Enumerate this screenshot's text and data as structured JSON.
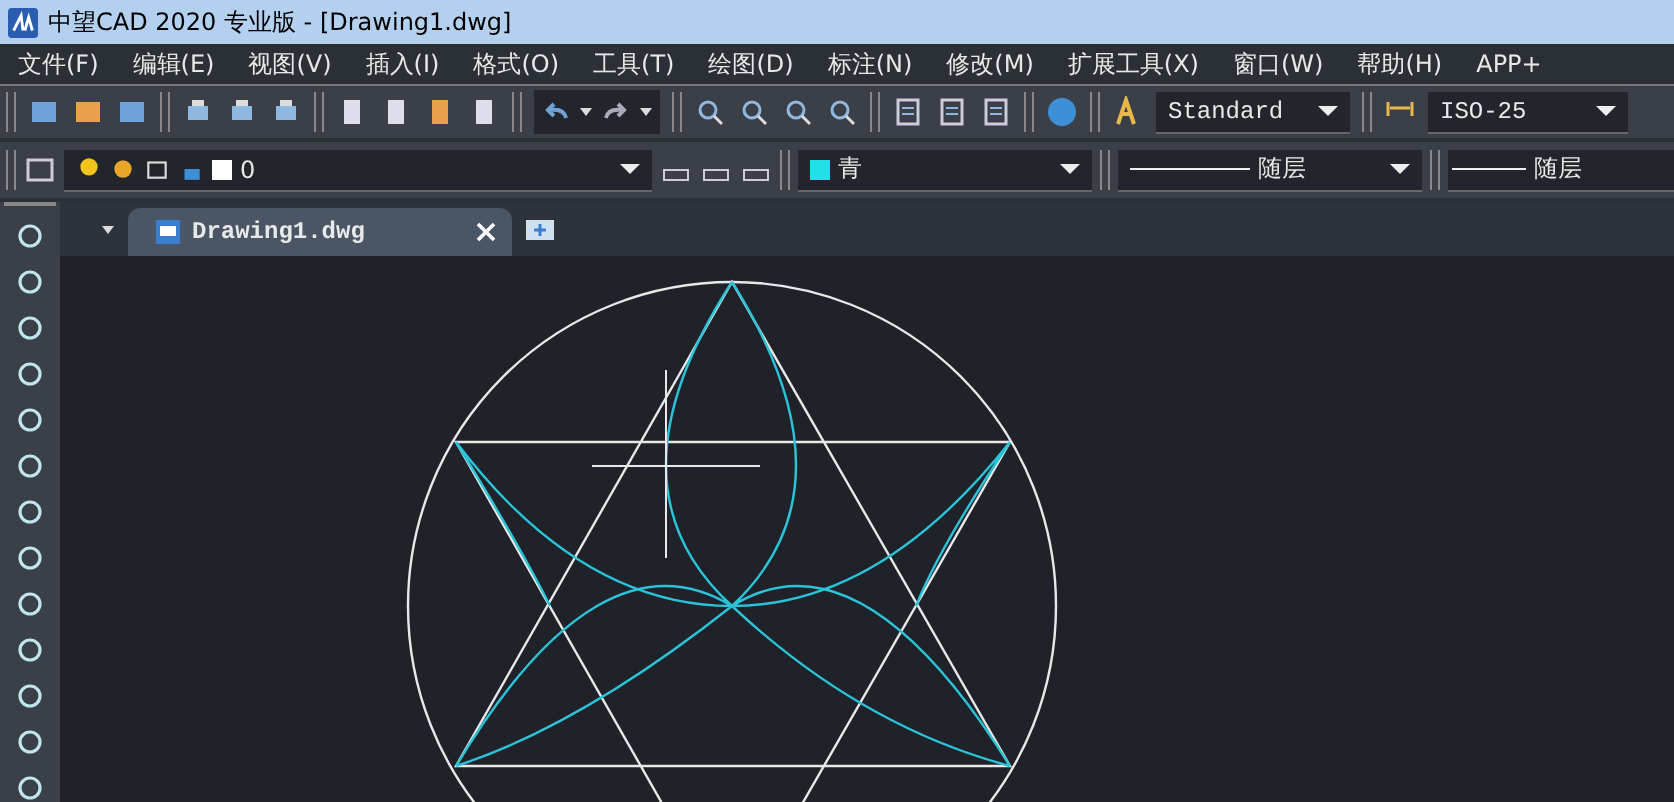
{
  "window": {
    "title": "中望CAD 2020 专业版 - [Drawing1.dwg]"
  },
  "menu": [
    "文件(F)",
    "编辑(E)",
    "视图(V)",
    "插入(I)",
    "格式(O)",
    "工具(T)",
    "绘图(D)",
    "标注(N)",
    "修改(M)",
    "扩展工具(X)",
    "窗口(W)",
    "帮助(H)",
    "APP+"
  ],
  "toolbar": {
    "text_style": "Standard",
    "dim_style": "ISO-25"
  },
  "layer_bar": {
    "layer": "0",
    "color": {
      "name": "青",
      "color": "#22e0e8"
    },
    "linetype": "随层",
    "lineweight": "随层"
  },
  "tabs": [
    {
      "label": "Drawing1.dwg",
      "selected": true
    }
  ]
}
